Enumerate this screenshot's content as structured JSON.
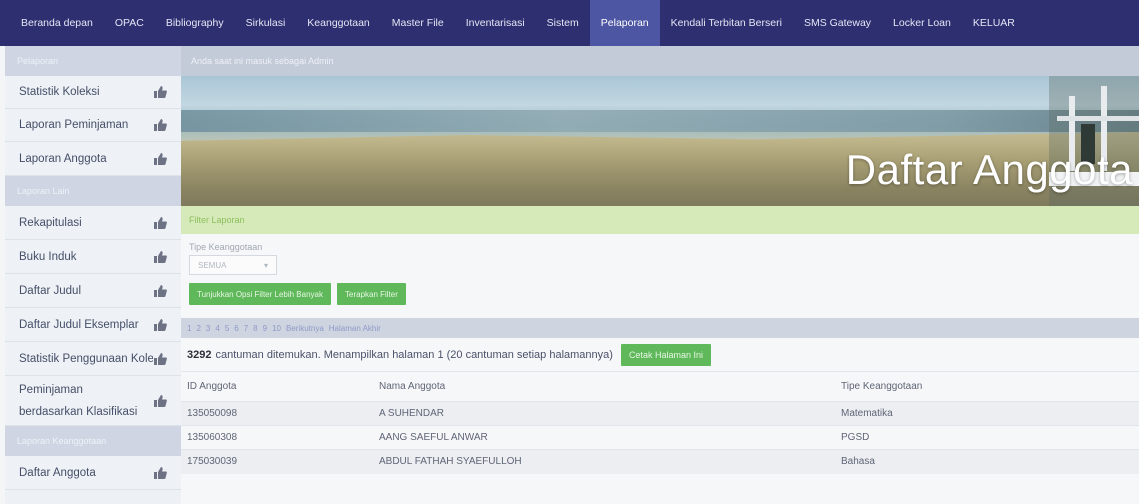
{
  "nav": {
    "items": [
      "Beranda depan",
      "OPAC",
      "Bibliography",
      "Sirkulasi",
      "Keanggotaan",
      "Master File",
      "Inventarisasi",
      "Sistem",
      "Pelaporan",
      "Kendali Terbitan Berseri",
      "SMS Gateway",
      "Locker Loan",
      "KELUAR"
    ],
    "active": "Pelaporan"
  },
  "sidebar": {
    "section1": "Pelaporan",
    "section2": "Laporan Lain",
    "section3": "Laporan Keanggotaan",
    "items1": [
      "Statistik Koleksi",
      "Laporan Peminjaman",
      "Laporan Anggota"
    ],
    "items2": [
      "Rekapitulasi",
      "Buku Induk",
      "Daftar Judul",
      "Daftar Judul Eksemplar",
      "Statistik Penggunaan Koleksi",
      "Peminjaman berdasarkan Klasifikasi"
    ],
    "items3": [
      "Daftar Anggota"
    ]
  },
  "main": {
    "notice": "Anda saat ini masuk sebagai Admin",
    "banner_title": "Daftar Anggota",
    "filter_header": "Filter Laporan",
    "filter_label": "Tipe Keanggotaan",
    "select_value": "SEMUA",
    "btn_more_filter": "Tunjukkan Opsi Filter Lebih Banyak",
    "btn_apply_filter": "Terapkan Filter",
    "pager": [
      "1",
      "2",
      "3",
      "4",
      "5",
      "6",
      "7",
      "8",
      "9",
      "10",
      "Berikutnya",
      "Halaman Akhir"
    ],
    "result_count": "3292",
    "result_text": "cantuman ditemukan. Menampilkan halaman 1 (20 cantuman setiap halamannya)",
    "btn_print": "Cetak Halaman Ini"
  },
  "table": {
    "headers": [
      "ID Anggota",
      "Nama Anggota",
      "Tipe Keanggotaan"
    ],
    "rows": [
      [
        "135050098",
        "A SUHENDAR",
        "Matematika"
      ],
      [
        "135060308",
        "AANG SAEFUL ANWAR",
        "PGSD"
      ],
      [
        "175030039",
        "ABDUL FATHAH SYAEFULLOH",
        "Bahasa"
      ]
    ]
  },
  "colors": {
    "nav_bg": "#2e2f70",
    "nav_active": "#4d56a3",
    "accent_green": "#5fb85a"
  }
}
